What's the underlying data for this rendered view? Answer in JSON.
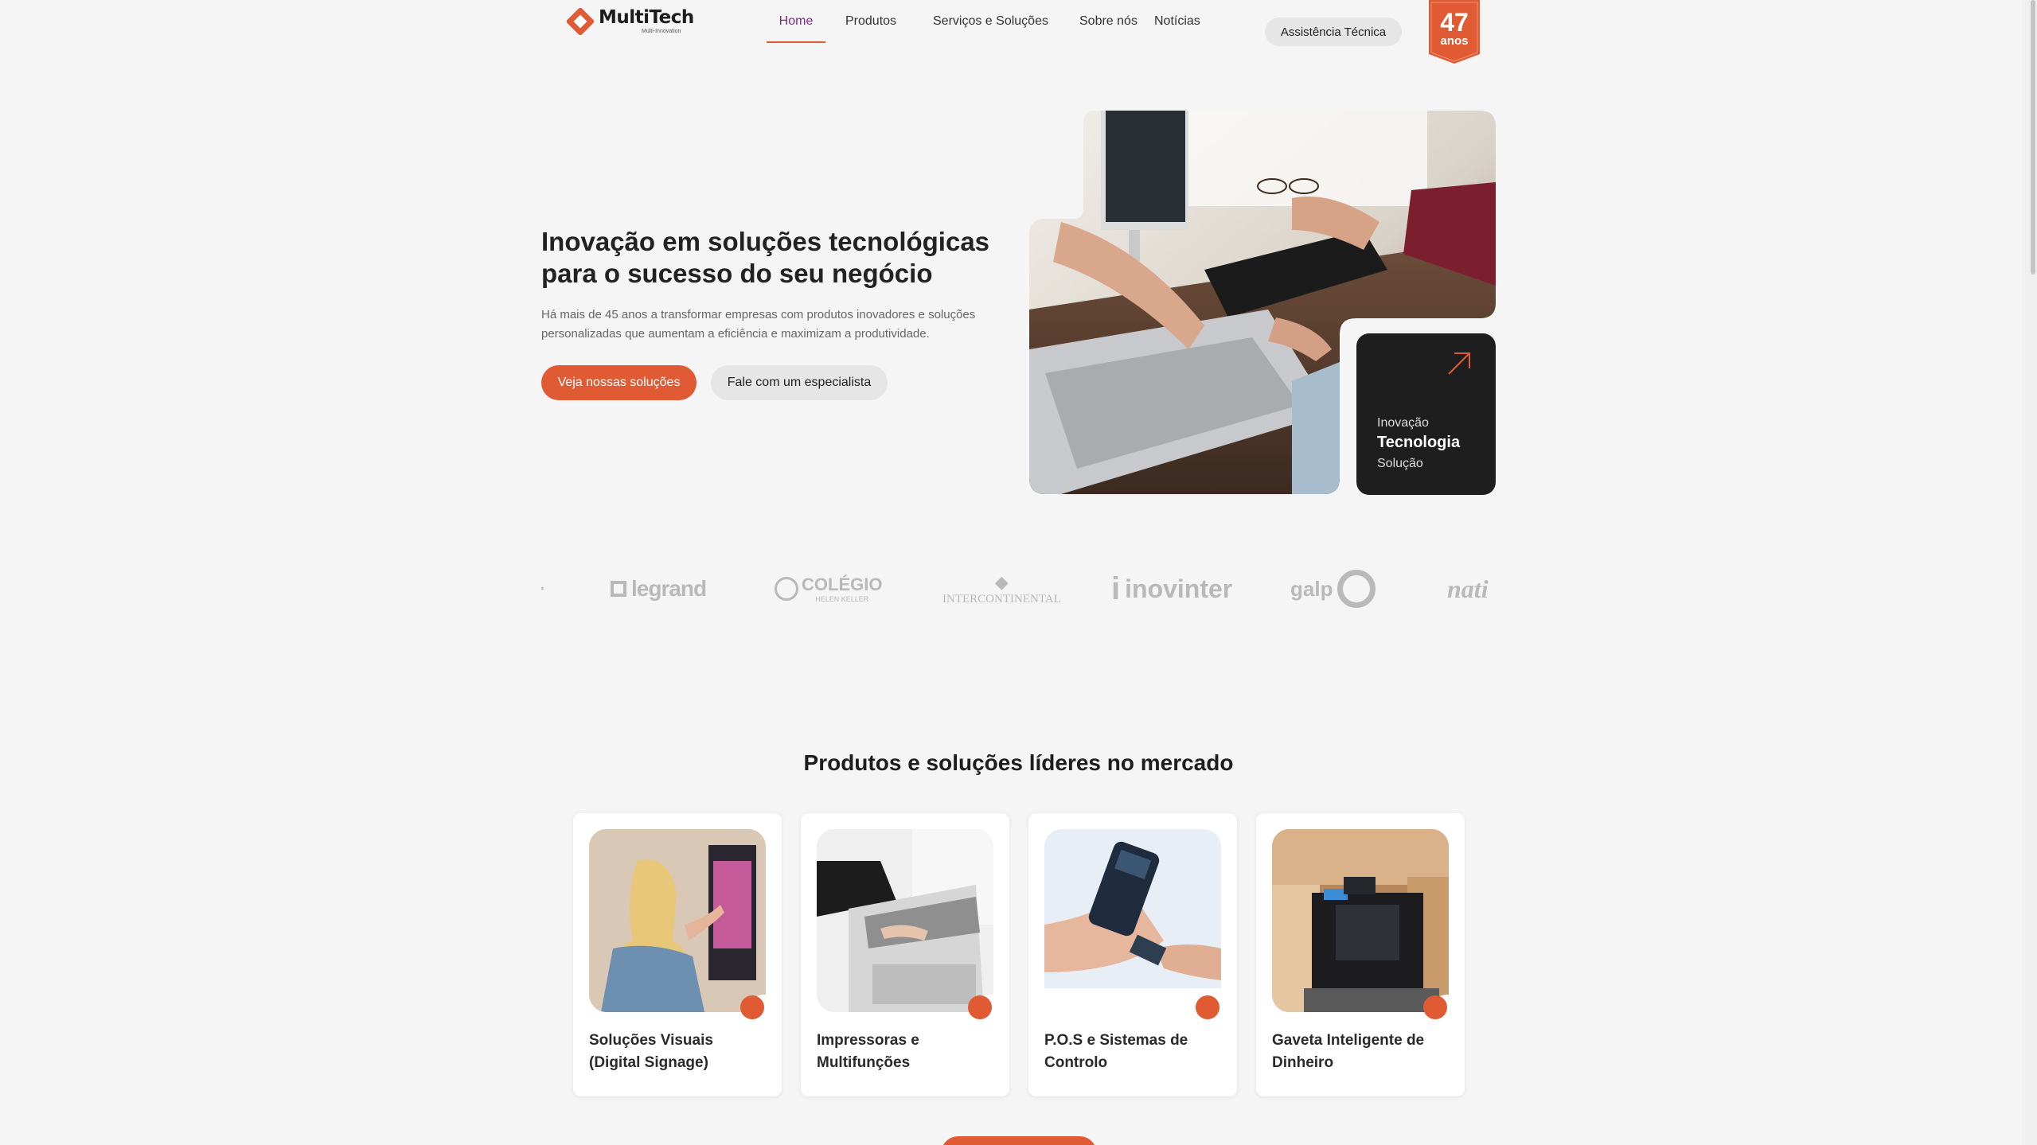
{
  "brand": {
    "name": "MultiTech",
    "tagline": "Multi-Innovation"
  },
  "nav": {
    "items": [
      {
        "label": "Home",
        "active": true
      },
      {
        "label": "Produtos"
      },
      {
        "label": "Serviços e Soluções"
      },
      {
        "label": "Sobre nós"
      },
      {
        "label": "Notícias"
      }
    ],
    "assist_label": "Assistência Técnica"
  },
  "badge": {
    "number": "47",
    "label": "anos"
  },
  "hero": {
    "title": "Inovação em soluções tecnológicas para o sucesso do seu negócio",
    "description": "Há mais de 45 anos a transformar empresas com produtos inovadores e soluções personalizadas que aumentam a eficiência e maximizam a produtividade.",
    "primary_cta": "Veja nossas soluções",
    "secondary_cta": "Fale com um especialista",
    "card": {
      "line1": "Inovação",
      "line2": "Tecnologia",
      "line3": "Solução"
    }
  },
  "clients": [
    {
      "name": "legrand"
    },
    {
      "name": "COLÉGIO",
      "sub": "HELEN KELLER"
    },
    {
      "name": "INTERCONTINENTAL"
    },
    {
      "name": "inovinter"
    },
    {
      "name": "galp"
    },
    {
      "name": "nati"
    }
  ],
  "products": {
    "title": "Produtos e soluções líderes no mercado",
    "items": [
      {
        "title": "Soluções Visuais (Digital Signage)"
      },
      {
        "title": "Impressoras e Multifunções"
      },
      {
        "title": "P.O.S e Sistemas de Controlo"
      },
      {
        "title": "Gaveta Inteligente de Dinheiro"
      }
    ]
  },
  "colors": {
    "accent": "#e05a33",
    "nav_active": "#7a2a8a",
    "dark_card": "#1e1e1e",
    "background": "#f5f5f5"
  }
}
